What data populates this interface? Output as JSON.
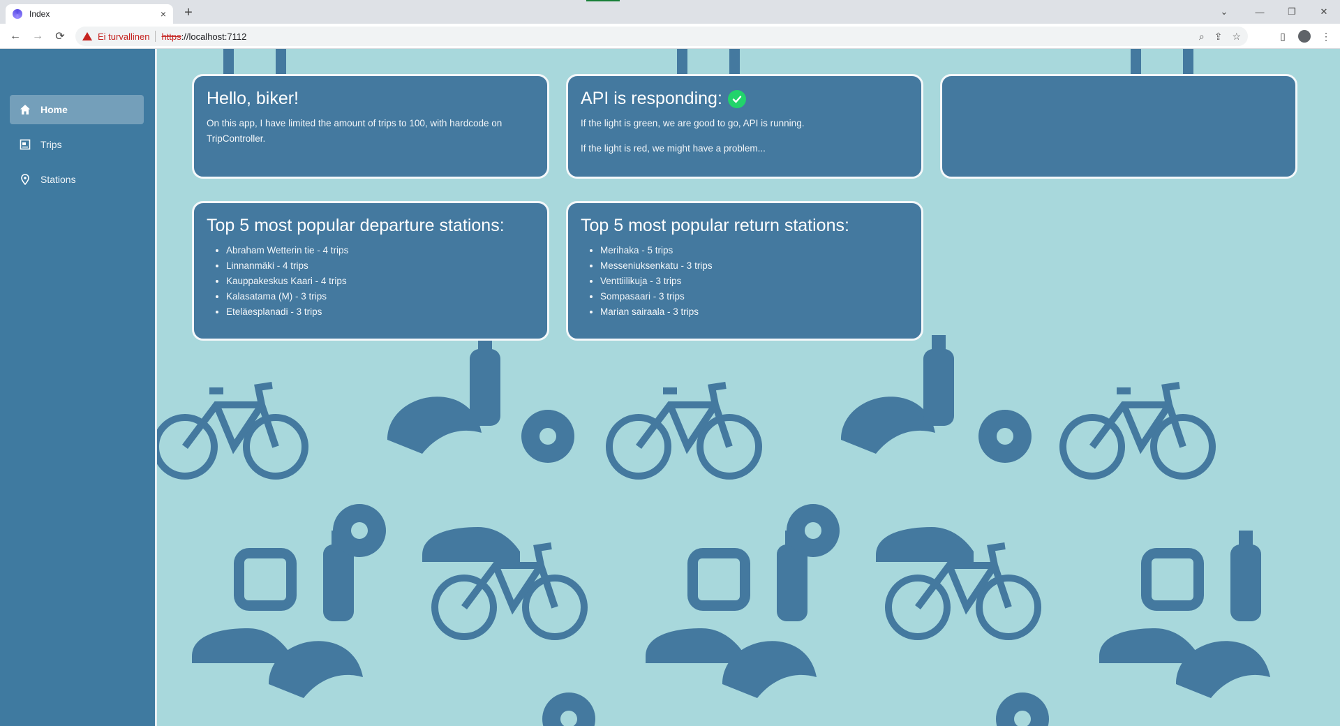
{
  "browser": {
    "tab_title": "Index",
    "tab_close": "×",
    "new_tab": "+",
    "security_label": "Ei turvallinen",
    "url_scheme": "https",
    "url_rest": "://localhost:7112",
    "back": "←",
    "forward": "→",
    "reload": "⟳",
    "zoom_icon": "⌕",
    "share_icon": "⇪",
    "bookmark_icon": "☆",
    "sidepanel_icon": "▯",
    "menu_icon": "⋮",
    "win_chevron": "⌄",
    "win_min": "—",
    "win_restore": "❐",
    "win_close": "✕"
  },
  "sidebar": {
    "items": [
      {
        "label": "Home",
        "icon": "home-icon",
        "active": true
      },
      {
        "label": "Trips",
        "icon": "trips-icon",
        "active": false
      },
      {
        "label": "Stations",
        "icon": "location-pin-icon",
        "active": false
      }
    ]
  },
  "cards": {
    "hello": {
      "title": "Hello, biker!",
      "text": "On this app, I have limited the amount of trips to 100, with hardcode on TripController."
    },
    "api": {
      "title": "API is responding:",
      "status_color": "#22d36b",
      "line1": "If the light is green, we are good to go, API is running.",
      "line2": "If the light is red, we might have a problem..."
    },
    "departures": {
      "title": "Top 5 most popular departure stations:",
      "items": [
        "Abraham Wetterin tie - 4 trips",
        "Linnanmäki - 4 trips",
        "Kauppakeskus Kaari - 4 trips",
        "Kalasatama (M) - 3 trips",
        "Eteläesplanadi - 3 trips"
      ]
    },
    "returns": {
      "title": "Top 5 most popular return stations:",
      "items": [
        "Merihaka - 5 trips",
        "Messeniuksenkatu - 3 trips",
        "Venttiilikuja - 3 trips",
        "Sompasaari - 3 trips",
        "Marian sairaala - 3 trips"
      ]
    }
  },
  "colors": {
    "sidebar": "#3f7aa0",
    "background": "#a8d8dc",
    "card": "#44799f",
    "pattern": "#44799f"
  }
}
